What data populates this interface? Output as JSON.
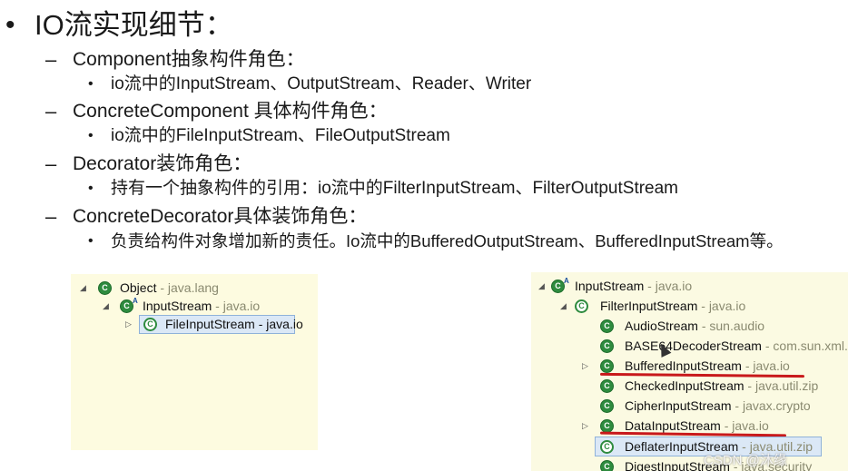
{
  "title": {
    "bullet": "•",
    "text": "IO流实现细节："
  },
  "items": [
    {
      "dash": "–",
      "label": "Component抽象构件角色：",
      "sub": " io流中的InputStream、OutputStream、Reader、Writer"
    },
    {
      "dash": "–",
      "label": "ConcreteComponent 具体构件角色：",
      "sub": "io流中的FileInputStream、FileOutputStream"
    },
    {
      "dash": "–",
      "label": "Decorator装饰角色：",
      "sub": "持有一个抽象构件的引用：io流中的FilterInputStream、FilterOutputStream"
    },
    {
      "dash": "–",
      "label": "ConcreteDecorator具体装饰角色：",
      "sub": "负责给构件对象增加新的责任。Io流中的BufferedOutputStream、BufferedInputStream等。"
    }
  ],
  "left_tree": [
    {
      "name": "Object",
      "pkg": " - java.lang",
      "icon": "class-icon"
    },
    {
      "name": "InputStream",
      "pkg": " - java.io",
      "icon": "abstract-class-icon"
    },
    {
      "name": "FileInputStream - java.io",
      "pkg": "",
      "icon": "class-icon",
      "selected": true
    }
  ],
  "right_tree": [
    {
      "name": "InputStream",
      "pkg": " - java.io",
      "icon": "abstract-class-icon"
    },
    {
      "name": "FilterInputStream",
      "pkg": " - java.io",
      "icon": "class-icon"
    },
    {
      "name": "AudioStream",
      "pkg": " - sun.audio",
      "icon": "class-icon"
    },
    {
      "name": "BASE64DecoderStream",
      "pkg": " - com.sun.xml.",
      "icon": "class-icon"
    },
    {
      "name": "BufferedInputStream",
      "pkg": " - java.io",
      "icon": "class-icon"
    },
    {
      "name": "CheckedInputStream",
      "pkg": " - java.util.zip",
      "icon": "class-icon"
    },
    {
      "name": "CipherInputStream",
      "pkg": " - javax.crypto",
      "icon": "class-icon"
    },
    {
      "name": "DataInputStream",
      "pkg": " - java.io",
      "icon": "class-icon"
    },
    {
      "name": "DeflaterInputStream",
      "pkg": " - java.util.zip",
      "icon": "class-icon",
      "selected": true
    },
    {
      "name": "DigestInputStream",
      "pkg": " - java.security",
      "icon": "class-icon"
    }
  ],
  "watermark": "CSDN @沐缘",
  "colors": {
    "class_icon": "#2e8b3e",
    "highlight_underline": "#c8191b",
    "panel_bg": "#fdfbe0"
  }
}
